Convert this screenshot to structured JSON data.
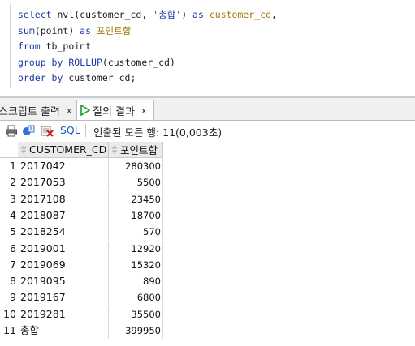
{
  "editor": {
    "lines": [
      [
        [
          "kw",
          "select"
        ],
        [
          "txt",
          " nvl(customer_cd, "
        ],
        [
          "str",
          "'총합'"
        ],
        [
          "txt",
          ") "
        ],
        [
          "kw",
          "as"
        ],
        [
          "txt",
          " "
        ],
        [
          "ident",
          "customer_cd"
        ],
        [
          "txt",
          ","
        ]
      ],
      [
        [
          "kw",
          "sum"
        ],
        [
          "txt",
          "(point) "
        ],
        [
          "kw",
          "as"
        ],
        [
          "txt",
          " "
        ],
        [
          "ident",
          "포인트합"
        ]
      ],
      [
        [
          "kw",
          "from"
        ],
        [
          "txt",
          " tb_point"
        ]
      ],
      [
        [
          "kw",
          "group by"
        ],
        [
          "txt",
          " "
        ],
        [
          "kw",
          "ROLLUP"
        ],
        [
          "txt",
          "(customer_cd)"
        ]
      ],
      [
        [
          "kw",
          "order by"
        ],
        [
          "txt",
          " customer_cd;"
        ]
      ]
    ]
  },
  "tabs": {
    "script_output": "스크립트 출력",
    "query_result": "질의 결과",
    "close_glyph": "x"
  },
  "toolbar": {
    "sql_label": "SQL",
    "separator": "|",
    "fetch_status": "인출된 모든 행: 11(0,003초)"
  },
  "grid": {
    "columns": [
      "CUSTOMER_CD",
      "포인트합"
    ],
    "rows": [
      {
        "n": "1",
        "customer_cd": "2017042",
        "points": "280300"
      },
      {
        "n": "2",
        "customer_cd": "2017053",
        "points": "5500"
      },
      {
        "n": "3",
        "customer_cd": "2017108",
        "points": "23450"
      },
      {
        "n": "4",
        "customer_cd": "2018087",
        "points": "18700"
      },
      {
        "n": "5",
        "customer_cd": "2018254",
        "points": "570"
      },
      {
        "n": "6",
        "customer_cd": "2019001",
        "points": "12920"
      },
      {
        "n": "7",
        "customer_cd": "2019069",
        "points": "15320"
      },
      {
        "n": "8",
        "customer_cd": "2019095",
        "points": "890"
      },
      {
        "n": "9",
        "customer_cd": "2019167",
        "points": "6800"
      },
      {
        "n": "10",
        "customer_cd": "2019281",
        "points": "35500"
      },
      {
        "n": "11",
        "customer_cd": "총합",
        "points": "399950"
      }
    ]
  },
  "colors": {
    "keyword": "#1b3aa6",
    "identifier": "#a07a00",
    "sql_link": "#1f5fb0",
    "run_icon": "#1f9b2e"
  },
  "icons": [
    "print-icon",
    "freeze-icon",
    "delete-icon",
    "run-query-icon",
    "sort-icon"
  ]
}
